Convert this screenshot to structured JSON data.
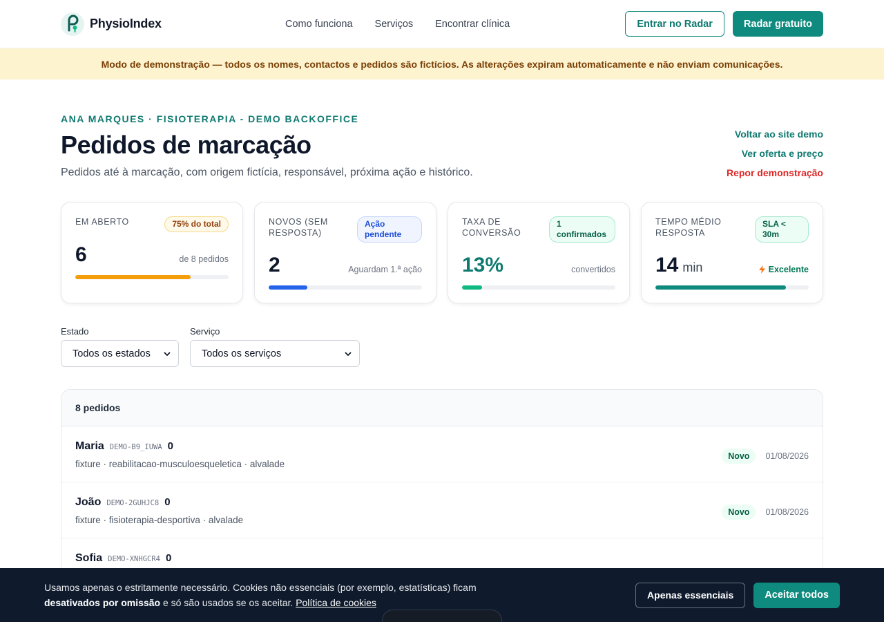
{
  "header": {
    "brand": "PhysioIndex",
    "nav": [
      "Como funciona",
      "Serviços",
      "Encontrar clínica"
    ],
    "login_label": "Entrar no Radar",
    "cta_label": "Radar gratuito"
  },
  "demo_banner": "Modo de demonstração — todos os nomes, contactos e pedidos são fictícios. As alterações expiram automaticamente e não enviam comunicações.",
  "page": {
    "eyebrow": "ANA MARQUES · FISIOTERAPIA - DEMO BACKOFFICE",
    "title": "Pedidos de marcação",
    "subtitle": "Pedidos até à marcação, com origem fictícia, responsável, próxima ação e histórico.",
    "links": {
      "back": "Voltar ao site demo",
      "offer": "Ver oferta e preço",
      "reset": "Repor demonstração"
    }
  },
  "kpis": [
    {
      "label": "EM ABERTO",
      "badge": "75% do total",
      "value": "6",
      "unit": "",
      "note": "de 8 pedidos",
      "progress": 0.75,
      "color": "#f59e0b"
    },
    {
      "label": "NOVOS (SEM RESPOSTA)",
      "badge": "Ação pendente",
      "value": "2",
      "unit": "",
      "note": "Aguardam 1.ª ação",
      "progress": 0.25,
      "color": "#2563eb"
    },
    {
      "label": "TAXA DE CONVERSÃO",
      "badge": "1 confirmados",
      "value": "13%",
      "unit": "",
      "note": "convertidos",
      "progress": 0.13,
      "color": "#10b981"
    },
    {
      "label": "TEMPO MÉDIO RESPOSTA",
      "badge": "SLA < 30m",
      "value": "14",
      "unit": "min",
      "note": "Excelente",
      "progress": 0.85,
      "color": "#0f8a7e"
    }
  ],
  "filters": {
    "estado": {
      "label": "Estado",
      "value": "Todos os estados"
    },
    "servico": {
      "label": "Serviço",
      "value": "Todos os serviços"
    }
  },
  "orders": {
    "count_label": "8 pedidos",
    "rows": [
      {
        "name": "Maria",
        "code": "DEMO-B9_IUWA",
        "count": "0",
        "meta": "fixture · reabilitacao-musculoesqueletica · alvalade",
        "status": "Novo",
        "date": "01/08/2026"
      },
      {
        "name": "João",
        "code": "DEMO-2GUHJC8",
        "count": "0",
        "meta": "fixture · fisioterapia-desportiva · alvalade",
        "status": "Novo",
        "date": "01/08/2026"
      },
      {
        "name": "Sofia",
        "code": "DEMO-XNHGCR4",
        "count": "0",
        "meta": "",
        "status": "",
        "date": ""
      }
    ]
  },
  "cookie": {
    "text_a": "Usamos apenas o estritamente necessário. Cookies não essenciais (por exemplo, estatísticas) ficam",
    "text_bold": "desativados por omissão",
    "text_b": " e só são usados se os aceitar. ",
    "policy_link": "Política de cookies",
    "essential_label": "Apenas essenciais",
    "accept_label": "Aceitar todos"
  }
}
